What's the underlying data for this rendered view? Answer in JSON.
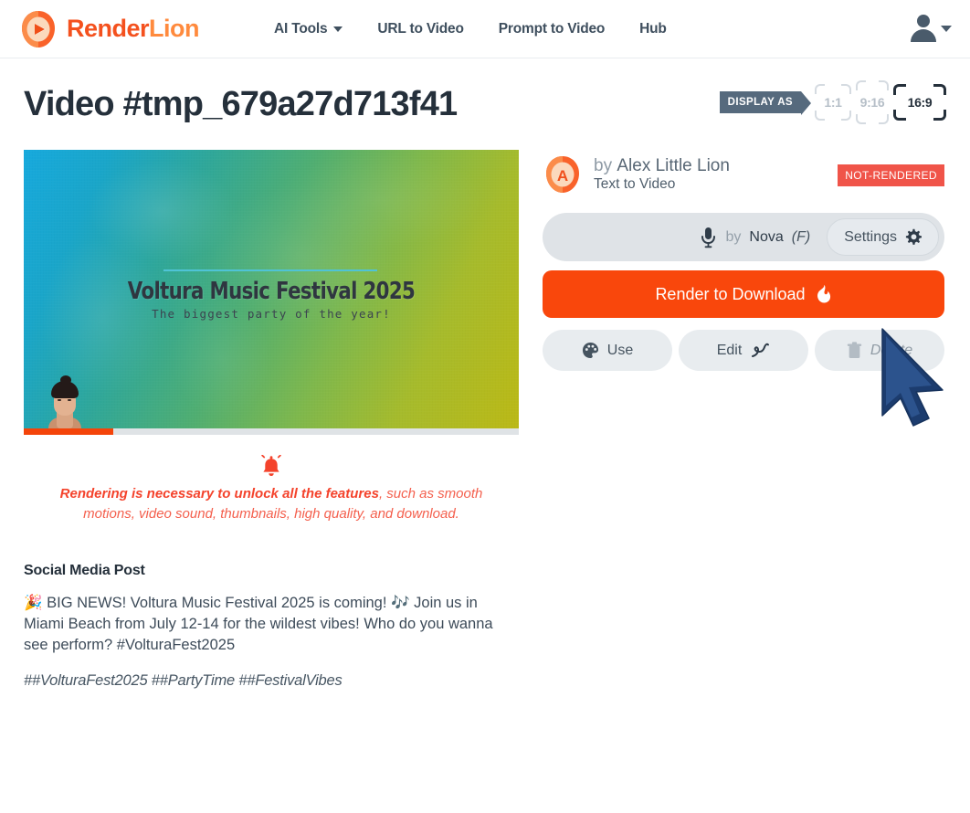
{
  "header": {
    "brand": {
      "first": "Render",
      "second": "Lion",
      "logo_icon": "lion-logo-icon"
    },
    "nav": [
      {
        "label": "AI Tools",
        "has_dropdown": true
      },
      {
        "label": "URL to Video",
        "has_dropdown": false
      },
      {
        "label": "Prompt to Video",
        "has_dropdown": false
      },
      {
        "label": "Hub",
        "has_dropdown": false
      }
    ],
    "user_menu": {
      "icon": "user-avatar-icon",
      "caret": "chevron-down-icon"
    }
  },
  "page": {
    "title": "Video #tmp_679a27d713f41",
    "display_as": {
      "label": "DISPLAY AS",
      "options": [
        {
          "label": "1:1",
          "selected": false
        },
        {
          "label": "9:16",
          "selected": false
        },
        {
          "label": "16:9",
          "selected": true
        }
      ]
    }
  },
  "video": {
    "headline": "Voltura Music Festival 2025",
    "subline": "The biggest party of the year!",
    "progress_percent": 18,
    "colors": {
      "gradient_start": "#17a9dd",
      "gradient_mid": "#4fae72",
      "gradient_end": "#bbb916",
      "progress_fill": "#f4440a",
      "progress_track": "#dfe3e6",
      "divider": "#4fc3d6"
    }
  },
  "notice": {
    "icon": "bell-icon",
    "bold_text": "Rendering is necessary to unlock all the features",
    "rest_text": ", such as smooth motions, video sound, thumbnails, high quality, and download.",
    "color": "#f4604e"
  },
  "social": {
    "heading": "Social Media Post",
    "body": "🎉 BIG NEWS! Voltura Music Festival 2025 is coming! 🎶 Join us in Miami Beach from July 12-14 for the wildest vibes! Who do you wanna see perform? #VolturaFest2025",
    "tags": "##VolturaFest2025 ##PartyTime ##FestivalVibes"
  },
  "details": {
    "author_prefix": "by",
    "author_name": "Alex Little Lion",
    "author_avatar_letter": "A",
    "kind": "Text to Video",
    "status": "NOT-RENDERED",
    "status_color": "#f05449",
    "voice": {
      "mic_icon": "microphone-icon",
      "by": "by",
      "name": "Nova",
      "gender": "(F)",
      "settings_label": "Settings",
      "settings_icon": "gear-icon"
    },
    "render_button": {
      "label": "Render to Download",
      "icon": "flame-icon",
      "color": "#f9470c"
    },
    "actions": [
      {
        "label": "Use",
        "icon": "palette-icon"
      },
      {
        "label": "Edit",
        "icon": "pen-squiggle-icon"
      },
      {
        "label": "Delete",
        "icon": "trash-icon"
      }
    ]
  },
  "cursor": {
    "icon": "mouse-pointer-icon"
  }
}
